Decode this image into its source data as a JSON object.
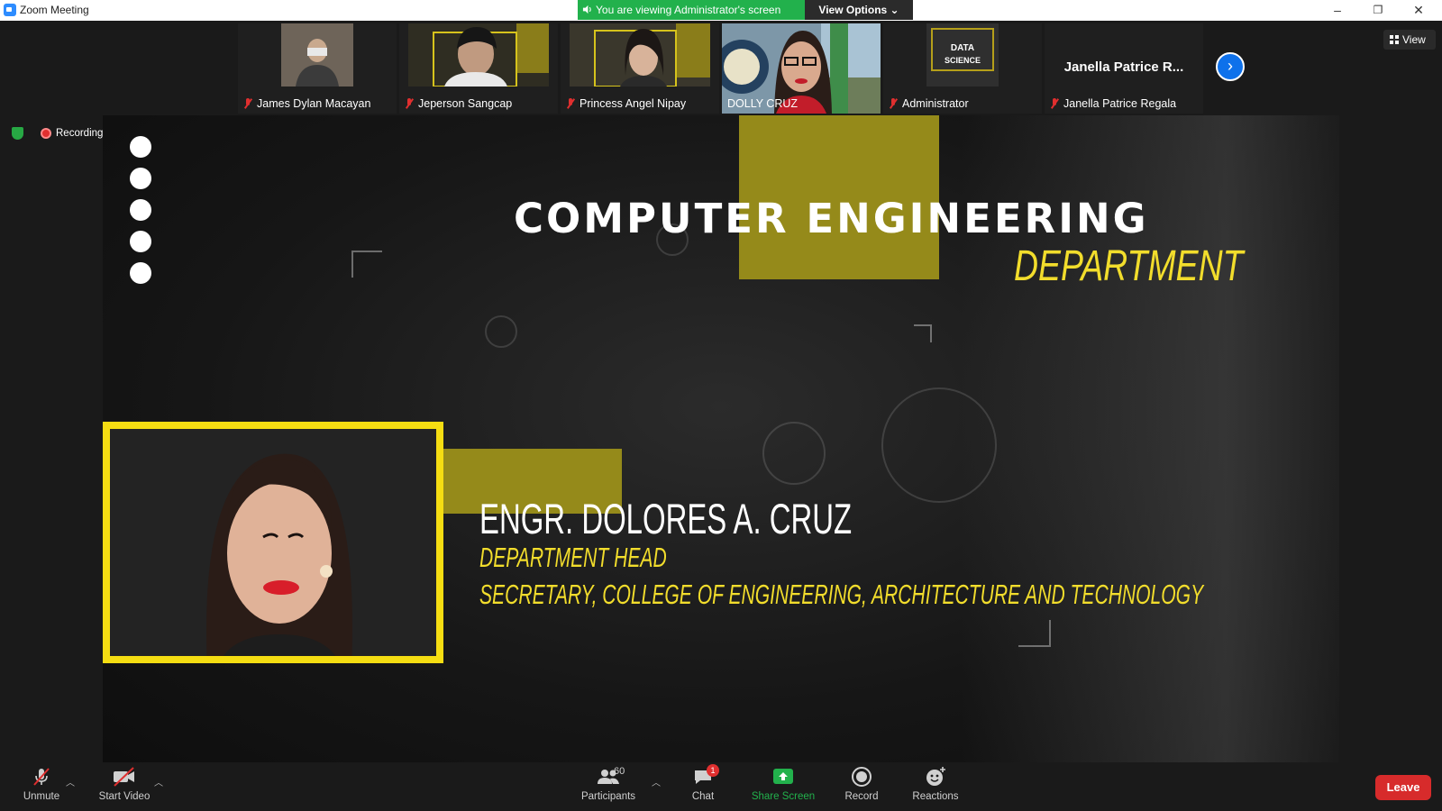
{
  "window": {
    "title": "Zoom Meeting",
    "minimize": "–",
    "restore": "❐",
    "close": "✕"
  },
  "banner": {
    "viewing_text": "You are viewing Administrator's screen",
    "view_options_label": "View Options ⌄"
  },
  "participants_strip": [
    {
      "name": "James Dylan Macayan",
      "muted": true,
      "thumb_color": "#6b6055"
    },
    {
      "name": "Jeperson Sangcap",
      "muted": true,
      "thumb_color": "#3a3a2a"
    },
    {
      "name": "Princess Angel Nipay",
      "muted": true,
      "thumb_color": "#4a4634"
    },
    {
      "name": "DOLLY CRUZ",
      "muted": false,
      "active_speaker": true,
      "thumb_color": "#5a7c52"
    },
    {
      "name": "Administrator",
      "muted": true,
      "thumb_color": "#3c3c3c",
      "thumb_text": "DATA SCIENCE"
    },
    {
      "name": "Janella Patrice Regala",
      "muted": true,
      "display_name": "Janella Patrice R..."
    }
  ],
  "strip_next_icon": "›",
  "view_button": {
    "label": "View"
  },
  "status": {
    "recording_label": "Recording"
  },
  "shared_screen": {
    "title_line1": "COMPUTER ENGINEERING",
    "title_line2": "DEPARTMENT",
    "person_name": "ENGR. DOLORES A. CRUZ",
    "role_line1": "DEPARTMENT HEAD",
    "role_line2": "SECRETARY, COLLEGE OF ENGINEERING, ARCHITECTURE AND TECHNOLOGY",
    "accent_gold": "#958a1a",
    "accent_yellow": "#f2dd2c"
  },
  "toolbar": {
    "unmute": "Unmute",
    "start_video": "Start Video",
    "participants": "Participants",
    "participants_count": "60",
    "chat": "Chat",
    "chat_badge": "1",
    "share_screen": "Share Screen",
    "record": "Record",
    "reactions": "Reactions",
    "leave": "Leave"
  },
  "colors": {
    "share_green": "#22b14c",
    "leave_red": "#d72b2b",
    "zoom_blue": "#0e71eb"
  }
}
